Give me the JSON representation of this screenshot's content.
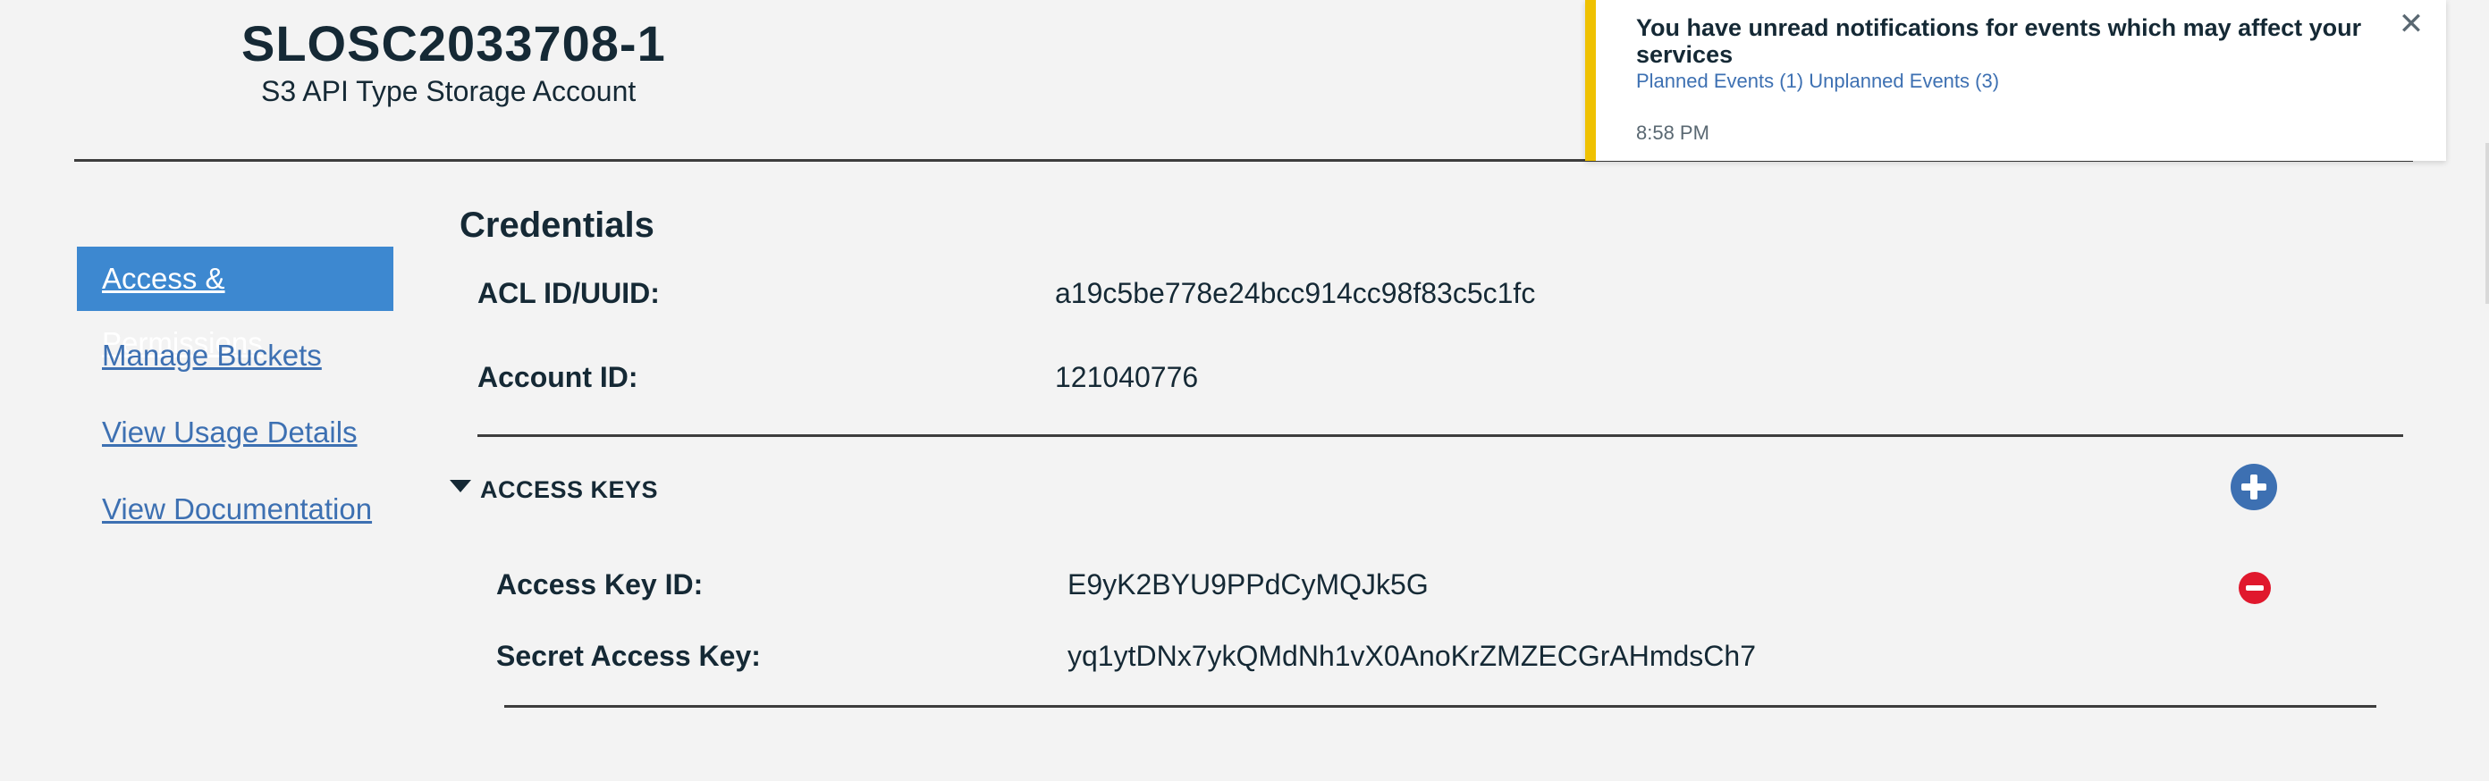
{
  "header": {
    "account_name": "SLOSC2033708-1",
    "account_type": "S3 API Type Storage Account"
  },
  "notification": {
    "title": "You have unread notifications for events which may affect your services",
    "planned_link": "Planned Events (1)",
    "unplanned_link": "Unplanned Events (3)",
    "time": "8:58 PM",
    "close_glyph": "✕",
    "accent_color": "#efc100"
  },
  "sidebar": {
    "items": [
      {
        "label": "Access & Permissions",
        "active": true
      },
      {
        "label": "Manage Buckets",
        "active": false
      },
      {
        "label": "View Usage Details",
        "active": false
      },
      {
        "label": "View Documentation",
        "active": false
      }
    ],
    "active_color": "#3d88d0",
    "link_color": "#3d70b2"
  },
  "credentials": {
    "title": "Credentials",
    "acl_label": "ACL ID/UUID:",
    "acl_value": "a19c5be778e24bcc914cc98f83c5c1fc",
    "account_label": "Account ID:",
    "account_value": "121040776"
  },
  "access_keys": {
    "section_label": "ACCESS KEYS",
    "expanded": true,
    "add_icon": "plus-circle-icon",
    "remove_icon": "minus-circle-icon",
    "key_id_label": "Access Key ID:",
    "key_id_value": "E9yK2BYU9PPdCyMQJk5G",
    "secret_label": "Secret Access Key:",
    "secret_value": "yq1ytDNx7ykQMdNh1vX0AnoKrZMZECGrAHmdsCh7"
  }
}
